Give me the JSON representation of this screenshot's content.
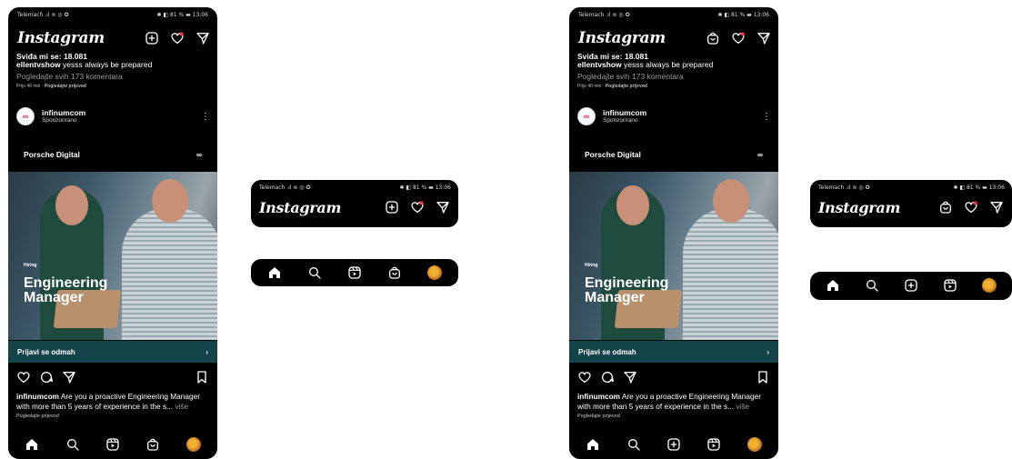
{
  "status": {
    "carrier": "Telemach",
    "signal_glyph": ".ıl ≋ ◎ ✪",
    "right": "✱ ◧ 81 % ▬ 13:06"
  },
  "header": {
    "logo": "Instagram"
  },
  "post_top": {
    "likes_cut": "Sviđa mi se: 18.081",
    "comment_user": "ellentvshow",
    "comment_text": " yesss always be prepared",
    "view_comments": "Pogledajte svih 173 komentara",
    "time_translate_prefix": "Prije 40 min · ",
    "time_translate_link": "Pogledajte prijevod"
  },
  "sponsor": {
    "avatar_glyph": "∞",
    "name": "infinumcom",
    "label": "Sponzorirano",
    "menu_glyph": "⋮"
  },
  "ad": {
    "brand": "Porsche Digital",
    "brand_logo": "∞",
    "hiring": "Hiring",
    "title_line1": "Engineering",
    "title_line2": "Manager",
    "cta": "Prijavi se odmah",
    "cta_arrow": "›"
  },
  "caption": {
    "user": "infinumcom",
    "text": " Are you a proactive Engineering Manager with more than 5 years of experience in the s...",
    "more": " više",
    "translate": "Pogledajte prijevod"
  },
  "icons": {
    "header_a": [
      "plus-square-icon",
      "heart-icon",
      "send-icon"
    ],
    "header_b": [
      "shop-bag-icon",
      "heart-icon",
      "send-icon"
    ],
    "tabs_a": [
      "home-icon",
      "search-icon",
      "reels-icon",
      "shop-bag-icon",
      "profile-avatar"
    ],
    "tabs_b": [
      "home-icon",
      "search-icon",
      "plus-square-icon",
      "reels-icon",
      "profile-avatar"
    ]
  },
  "colors": {
    "background": "#000000",
    "cta_bar": "#15434a",
    "notification_dot": "#ff3040"
  }
}
